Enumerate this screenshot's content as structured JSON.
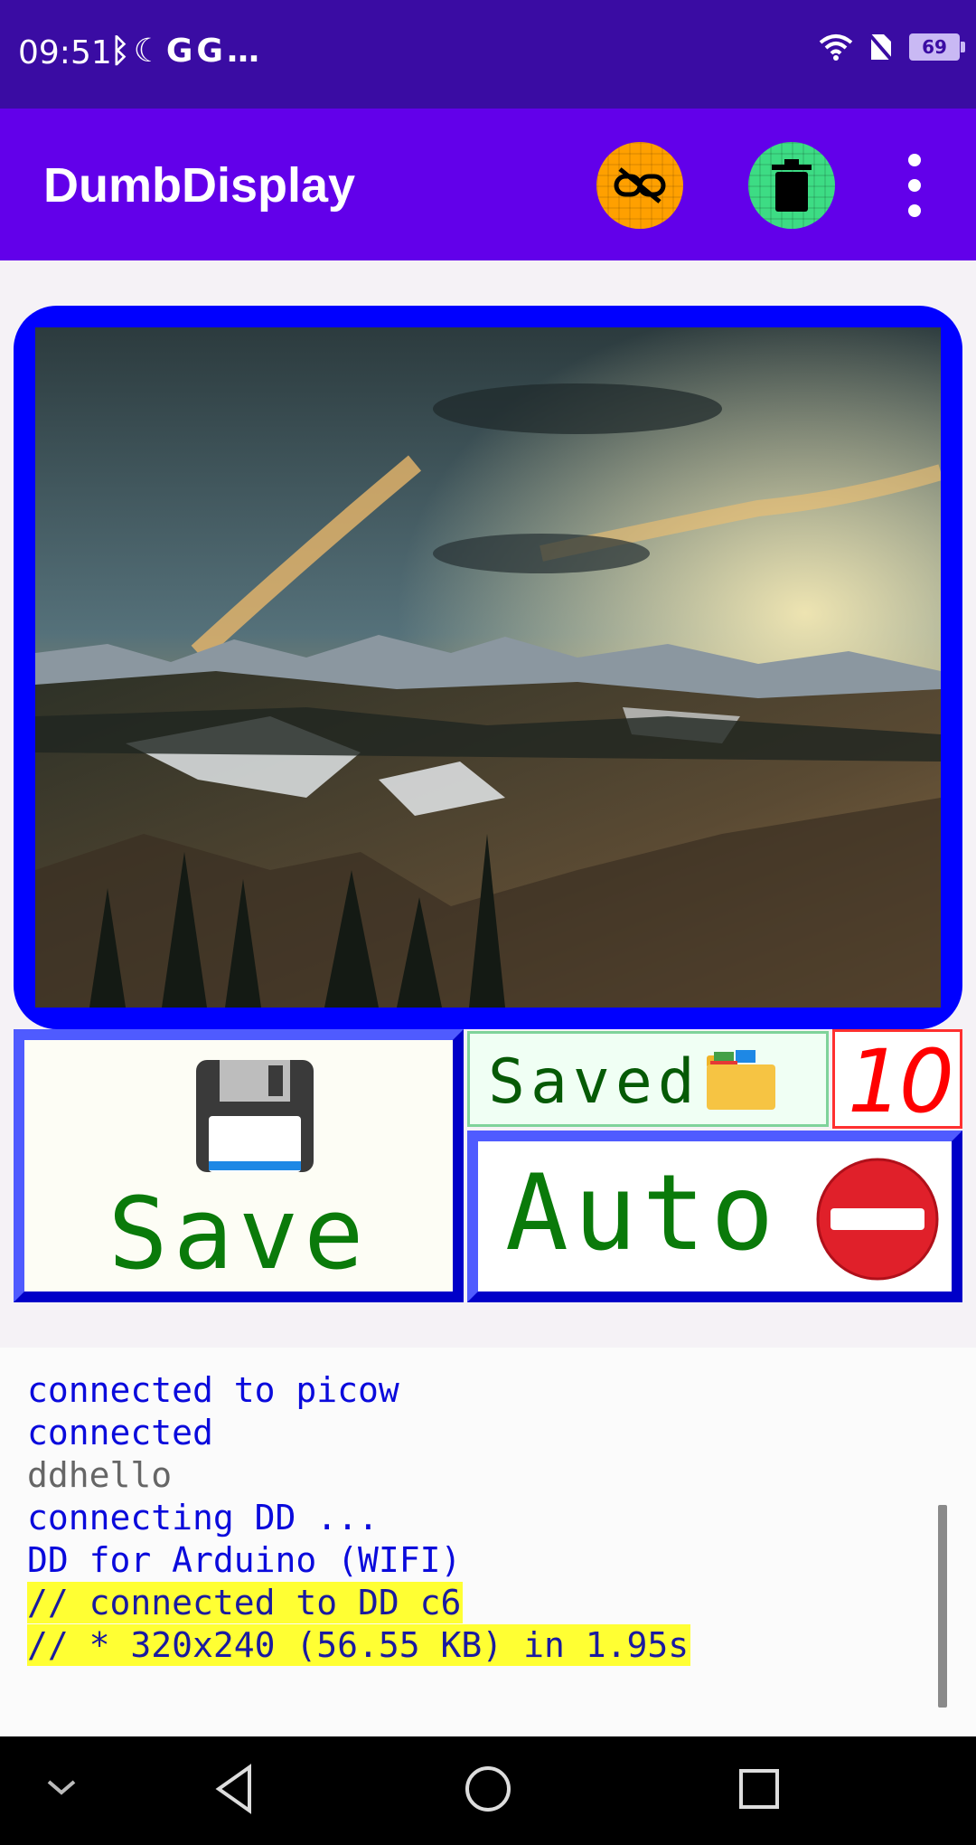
{
  "status_bar": {
    "time": "09:51",
    "left_icons": "ᛒ☾GG…",
    "battery": "69",
    "icons": [
      "bluetooth-icon",
      "moon-icon",
      "google-icon",
      "google-icon",
      "more-notifications-icon",
      "wifi-icon",
      "no-sim-icon",
      "battery-icon"
    ]
  },
  "app_bar": {
    "title": "DumbDisplay",
    "actions": [
      "unlink-icon",
      "trash-icon",
      "overflow-menu-icon"
    ],
    "colors": {
      "bar": "#6200ea",
      "unlink_bg": "#ffa000",
      "trash_bg": "#3ddc84"
    }
  },
  "display": {
    "image_subject": "mountain landscape at sunset",
    "frame_color": "#0000ff"
  },
  "controls": {
    "save_label": "Save",
    "save_icon": "floppy-disk-icon",
    "saved_label": "Saved",
    "saved_icon": "folder-icon",
    "counter": "10",
    "auto_label": "Auto",
    "auto_icon": "no-entry-icon"
  },
  "log": {
    "lines": [
      {
        "text": "connected to picow"
      },
      {
        "text": "connected"
      },
      {
        "text": "ddhello"
      },
      {
        "text": "connecting DD ..."
      },
      {
        "text": "DD for Arduino (WIFI)"
      },
      {
        "text": "// connected to DD c6"
      },
      {
        "text": "// * 320x240 (56.55 KB) in 1.95s"
      }
    ]
  },
  "nav_bar": {
    "items": [
      "collapse-icon",
      "back-icon",
      "home-icon",
      "recents-icon"
    ]
  }
}
